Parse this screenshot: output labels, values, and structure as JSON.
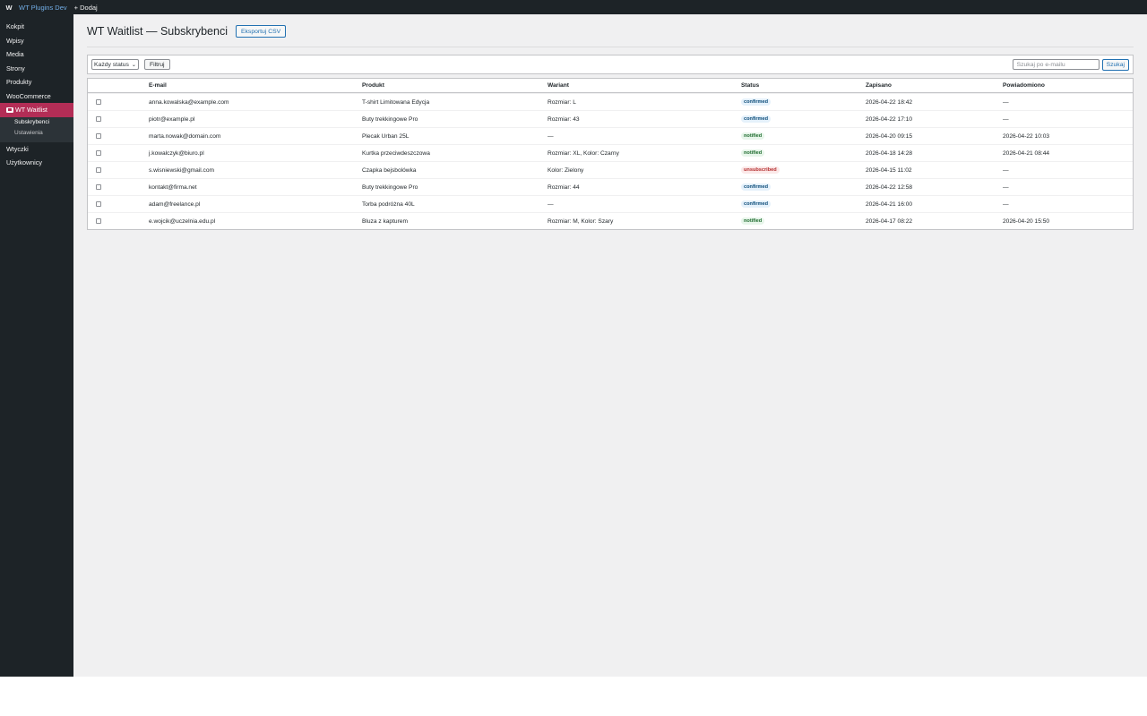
{
  "adminbar": {
    "logo": "W",
    "site_name": "WT Plugins Dev",
    "new_label": "+ Dodaj"
  },
  "sidebar": {
    "items": [
      {
        "label": "Kokpit"
      },
      {
        "label": "Wpisy"
      },
      {
        "label": "Media"
      },
      {
        "label": "Strony"
      },
      {
        "label": "Produkty"
      },
      {
        "label": "WooCommerce"
      },
      {
        "label": "WT Waitlist",
        "active": true,
        "icon": "mail-icon"
      },
      {
        "label": "Wtyczki"
      },
      {
        "label": "Użytkownicy"
      }
    ],
    "submenu": [
      {
        "label": "Subskrybenci",
        "current": true
      },
      {
        "label": "Ustawienia"
      }
    ]
  },
  "page": {
    "title": "WT Waitlist — Subskrybenci",
    "export_label": "Eksportuj CSV"
  },
  "toolbar": {
    "status_filter": "Każdy status",
    "filter_label": "Filtruj",
    "search_placeholder": "Szukaj po e-mailu",
    "search_label": "Szukaj"
  },
  "table": {
    "columns": [
      "E-mail",
      "Produkt",
      "Wariant",
      "Status",
      "Zapisano",
      "Powiadomiono"
    ],
    "rows": [
      {
        "email": "anna.kowalska@example.com",
        "product": "T-shirt Limitowana Edycja",
        "variant": "Rozmiar: L",
        "status": "confirmed",
        "saved": "2026-04-22 18:42",
        "notified": "—"
      },
      {
        "email": "piotr@example.pl",
        "product": "Buty trekkingowe Pro",
        "variant": "Rozmiar: 43",
        "status": "confirmed",
        "saved": "2026-04-22 17:10",
        "notified": "—"
      },
      {
        "email": "marta.nowak@domain.com",
        "product": "Plecak Urban 25L",
        "variant": "—",
        "status": "notified",
        "saved": "2026-04-20 09:15",
        "notified": "2026-04-22 10:03"
      },
      {
        "email": "j.kowalczyk@biuro.pl",
        "product": "Kurtka przeciwdeszczowa",
        "variant": "Rozmiar: XL, Kolor: Czarny",
        "status": "notified",
        "saved": "2026-04-18 14:28",
        "notified": "2026-04-21 08:44"
      },
      {
        "email": "s.wisniewski@gmail.com",
        "product": "Czapka bejsbolówka",
        "variant": "Kolor: Zielony",
        "status": "unsubscribed",
        "saved": "2026-04-15 11:02",
        "notified": "—"
      },
      {
        "email": "kontakt@firma.net",
        "product": "Buty trekkingowe Pro",
        "variant": "Rozmiar: 44",
        "status": "confirmed",
        "saved": "2026-04-22 12:58",
        "notified": "—"
      },
      {
        "email": "adam@freelance.pl",
        "product": "Torba podróżna 40L",
        "variant": "—",
        "status": "confirmed",
        "saved": "2026-04-21 16:00",
        "notified": "—"
      },
      {
        "email": "e.wojcik@uczelnia.edu.pl",
        "product": "Bluza z kapturem",
        "variant": "Rozmiar: M, Kolor: Szary",
        "status": "notified",
        "saved": "2026-04-17 08:22",
        "notified": "2026-04-20 15:50"
      }
    ]
  },
  "colors": {
    "adminbar_bg": "#1d2327",
    "accent_active": "#b32d56",
    "link_blue": "#2271b1",
    "content_bg": "#f0f0f1"
  }
}
